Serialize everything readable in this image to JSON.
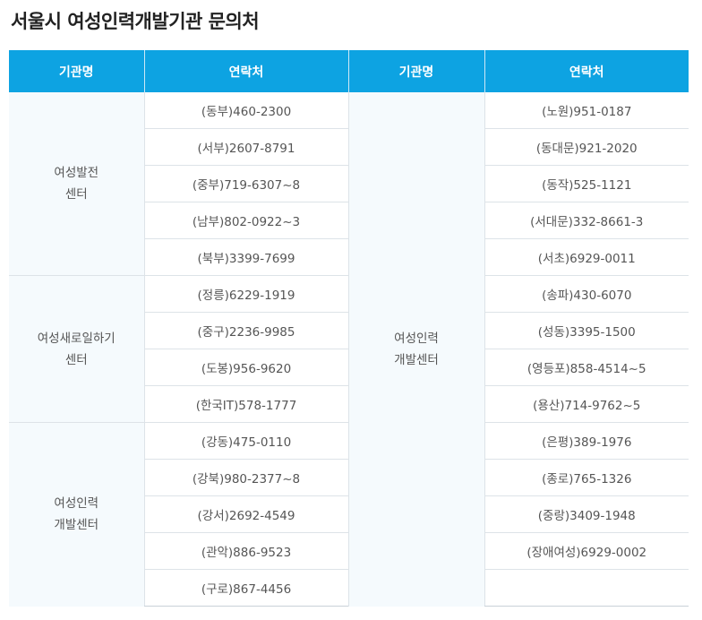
{
  "title": "서울시 여성인력개발기관 문의처",
  "headers": [
    "기관명",
    "연락처",
    "기관명",
    "연락처"
  ],
  "groups_left": [
    {
      "name": [
        "여성발전",
        "센터"
      ],
      "contacts": [
        "(동부)460-2300",
        "(서부)2607-8791",
        "(중부)719-6307~8",
        "(남부)802-0922~3",
        "(북부)3399-7699"
      ]
    },
    {
      "name": [
        "여성새로일하기",
        "센터"
      ],
      "contacts": [
        "(정릉)6229-1919",
        "(중구)2236-9985",
        "(도봉)956-9620",
        "(한국IT)578-1777"
      ]
    },
    {
      "name": [
        "여성인력",
        "개발센터"
      ],
      "contacts": [
        "(강동)475-0110",
        "(강북)980-2377~8",
        "(강서)2692-4549",
        "(관악)886-9523",
        "(구로)867-4456"
      ]
    }
  ],
  "right_org": {
    "name": [
      "여성인력",
      "개발센터"
    ]
  },
  "right_contacts": [
    "(노원)951-0187",
    "(동대문)921-2020",
    "(동작)525-1121",
    "(서대문)332-8661-3",
    "(서초)6929-0011",
    "(송파)430-6070",
    "(성동)3395-1500",
    "(영등포)858-4514~5",
    "(용산)714-9762~5",
    "(은평)389-1976",
    "(종로)765-1326",
    "(중랑)3409-1948",
    "(장애여성)6929-0002",
    ""
  ]
}
